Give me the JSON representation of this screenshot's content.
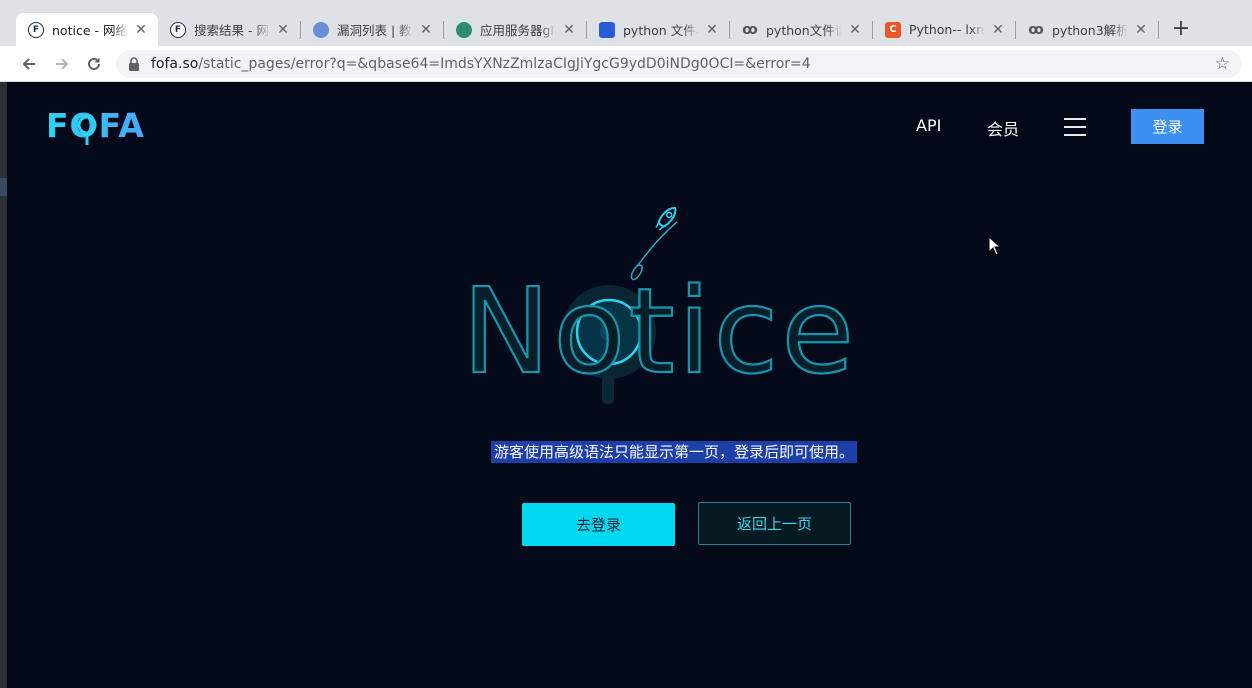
{
  "browser": {
    "tabs": [
      {
        "title": "notice - 网络空",
        "icon": "fofa-icon",
        "active": true
      },
      {
        "title": "搜索结果 - 网络",
        "icon": "fofa-icon"
      },
      {
        "title": "漏洞列表 | 教育",
        "icon": "globe-icon"
      },
      {
        "title": "应用服务器glas",
        "icon": "leaf-icon"
      },
      {
        "title": "python 文件与",
        "icon": "paw-icon"
      },
      {
        "title": "python文件读",
        "icon": "swirl-icon"
      },
      {
        "title": "Python-- lxml",
        "icon": "c-icon"
      },
      {
        "title": "python3解析",
        "icon": "swirl-icon"
      }
    ],
    "new_tab_label": "+",
    "close_glyph": "✕",
    "url_host": "fofa.so",
    "url_rest": "/static_pages/error?q=&qbase64=ImdsYXNzZmlzaCIgJiYgcG9ydD0iNDg0OCI=&error=4"
  },
  "header": {
    "logo_text": "FOFA",
    "nav": {
      "api": "API",
      "member": "会员"
    },
    "login_label": "登录"
  },
  "main": {
    "hero_word": "Notice",
    "message": "游客使用高级语法只能显示第一页，登录后即可使用。",
    "primary_button": "去登录",
    "secondary_button": "返回上一页"
  },
  "colors": {
    "accent": "#00d7f0",
    "login_blue": "#3d8ff2",
    "background": "#050a1a",
    "selection": "#1c3fa8"
  }
}
